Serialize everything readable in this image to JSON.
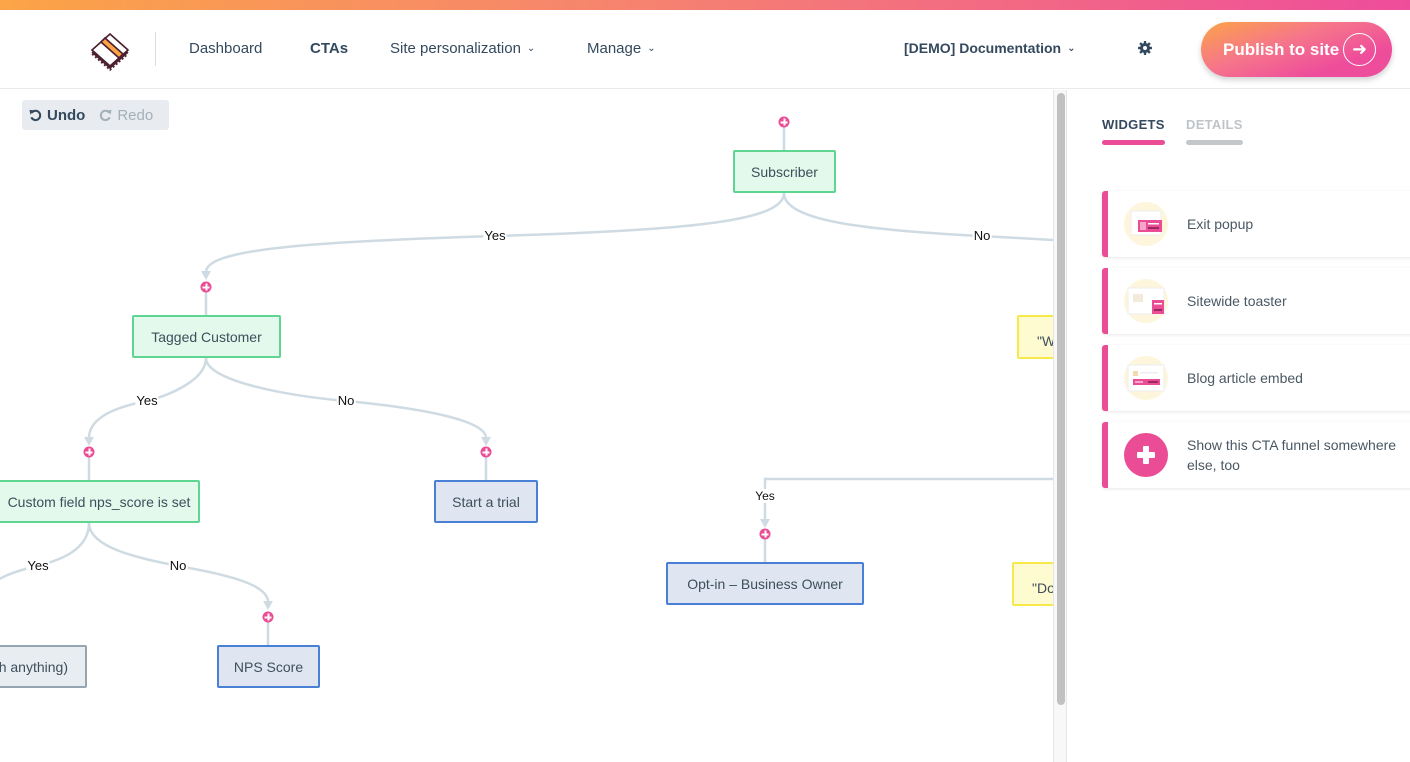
{
  "colors": {
    "accent": "#ea4c95",
    "gradient_start": "#fba447",
    "gradient_end": "#ee4d9b",
    "condition_border": "#5fd592",
    "cta_border": "#4a7fd6",
    "text_dark": "#34495e"
  },
  "header": {
    "nav": [
      {
        "label": "Dashboard",
        "active": false,
        "dropdown": false
      },
      {
        "label": "CTAs",
        "active": true,
        "dropdown": false
      },
      {
        "label": "Site personalization",
        "active": false,
        "dropdown": true
      },
      {
        "label": "Manage",
        "active": false,
        "dropdown": true
      }
    ],
    "account_select": "[DEMO] Documentation",
    "settings_icon": "gear-icon",
    "publish_label": "Publish to site",
    "publish_icon": "arrow-right-circle-icon"
  },
  "toolbar": {
    "undo_label": "Undo",
    "redo_label": "Redo",
    "redo_enabled": false
  },
  "flow": {
    "nodes": [
      {
        "id": "subscriber",
        "label": "Subscriber",
        "type": "condition"
      },
      {
        "id": "tagged-customer",
        "label": "Tagged Customer",
        "type": "condition"
      },
      {
        "id": "nps-set",
        "label": "Custom field nps_score is set",
        "type": "condition"
      },
      {
        "id": "start-trial",
        "label": "Start a trial",
        "type": "cta"
      },
      {
        "id": "nothing",
        "label": "h anything)",
        "type": "none"
      },
      {
        "id": "nps-score",
        "label": "NPS Score",
        "type": "cta"
      },
      {
        "id": "optin-owner",
        "label": "Opt-in – Business Owner",
        "type": "cta"
      },
      {
        "id": "yellow-w",
        "label": "\"W",
        "type": "note"
      },
      {
        "id": "yellow-do",
        "label": "\"Do",
        "type": "note"
      }
    ],
    "edge_labels": {
      "subscriber_yes": "Yes",
      "subscriber_no": "No",
      "tagged_yes": "Yes",
      "tagged_no": "No",
      "nps_yes": "Yes",
      "nps_no": "No",
      "optin_yes": "Yes"
    }
  },
  "sidebar": {
    "tabs": [
      {
        "label": "WIDGETS",
        "active": true
      },
      {
        "label": "DETAILS",
        "active": false
      }
    ],
    "widgets": [
      {
        "label": "Exit popup",
        "icon": "exit-popup-icon"
      },
      {
        "label": "Sitewide toaster",
        "icon": "sitewide-toaster-icon"
      },
      {
        "label": "Blog article embed",
        "icon": "blog-embed-icon"
      },
      {
        "label": "Show this CTA funnel somewhere else, too",
        "icon": "plus-icon"
      }
    ]
  }
}
